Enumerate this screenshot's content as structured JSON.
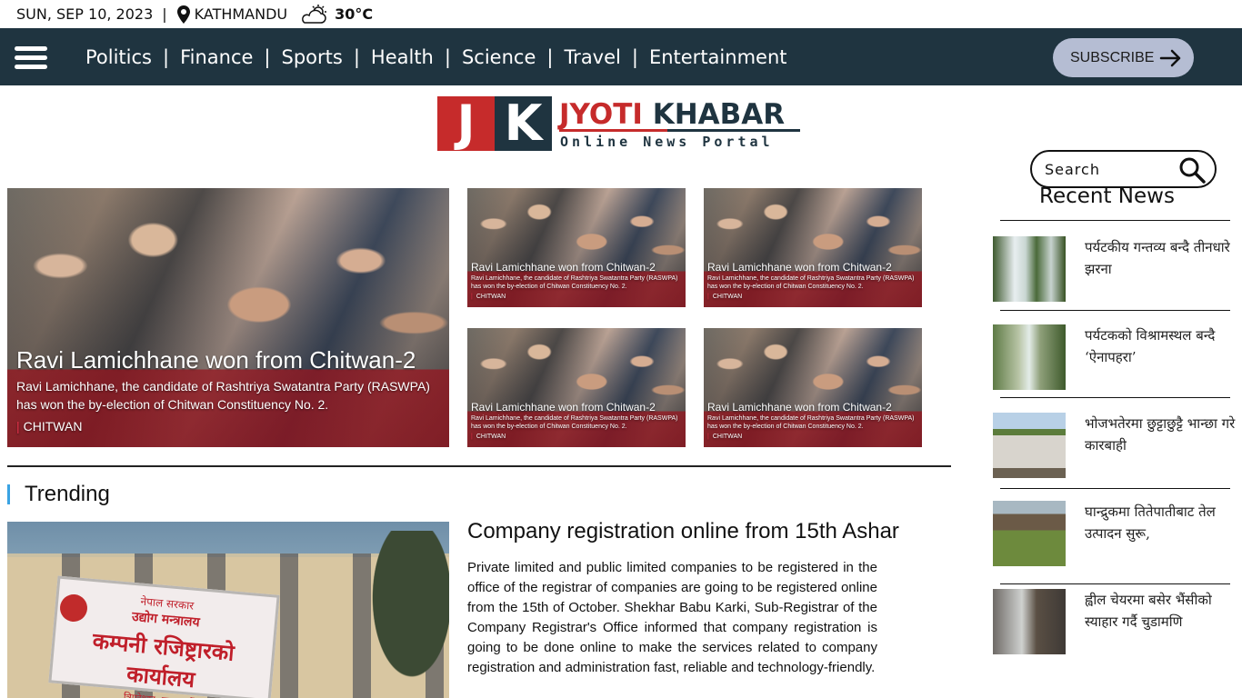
{
  "topbar": {
    "date": "SUN, SEP 10, 2023",
    "separator": "|",
    "location": "KATHMANDU",
    "temperature": "30°C",
    "icons": [
      "location-pin-icon",
      "partly-cloudy-icon"
    ]
  },
  "nav": {
    "items": [
      "Politics",
      "Finance",
      "Sports",
      "Health",
      "Science",
      "Travel",
      "Entertainment"
    ],
    "separator": "|",
    "subscribe_label": "SUBSCRIBE",
    "icons": [
      "hamburger-menu-icon",
      "arrow-right-icon"
    ]
  },
  "logo": {
    "letter_j": "J",
    "letter_k": "K",
    "name_part1": "JYOTI",
    "name_part2": "KHABAR",
    "tagline": "Online News Portal"
  },
  "colors": {
    "nav_bg": "#1f3440",
    "brand_red": "#c62b2b",
    "subscribe_bg": "#b5bdd3",
    "trending_accent": "#3aa3e3",
    "location_tick": "#e6324b"
  },
  "featured": {
    "hero": {
      "title": "Ravi Lamichhane won from Chitwan-2",
      "description": "Ravi Lamichhane, the candidate of Rashtriya Swatantra Party (RASWPA) has won the by-election of Chitwan Constituency No. 2.",
      "location": "CHITWAN"
    },
    "grid": [
      {
        "title": "Ravi Lamichhane won from Chitwan-2",
        "description": "Ravi Lamichhane, the candidate of Rashtriya Swatantra Party (RASWPA) has won the by-election of Chitwan Constituency No. 2.",
        "location": "CHITWAN"
      },
      {
        "title": "Ravi Lamichhane won from Chitwan-2",
        "description": "Ravi Lamichhane, the candidate of Rashtriya Swatantra Party (RASWPA) has won the by-election of Chitwan Constituency No. 2.",
        "location": "CHITWAN"
      },
      {
        "title": "Ravi Lamichhane won from Chitwan-2",
        "description": "Ravi Lamichhane, the candidate of Rashtriya Swatantra Party (RASWPA) has won the by-election of Chitwan Constituency No. 2.",
        "location": "CHITWAN"
      },
      {
        "title": "Ravi Lamichhane won from Chitwan-2",
        "description": "Ravi Lamichhane, the candidate of Rashtriya Swatantra Party (RASWPA) has won the by-election of Chitwan Constituency No. 2.",
        "location": "CHITWAN"
      }
    ]
  },
  "trending": {
    "heading": "Trending",
    "photo_banner": {
      "line1": "नेपाल सरकार",
      "line2": "उद्योग मन्त्रालय",
      "line3": "कम्पनी रजिष्ट्रारको कार्यालय",
      "line4": "त्रिपुरेश्वर, काठमाडौं"
    },
    "article": {
      "title": "Company registration online from 15th Ashar",
      "body": "Private limited and public limited companies to be registered in the office of the registrar of companies are going to be registered online from the 15th of October. Shekhar Babu Karki, Sub-Registrar of the Company Registrar's Office informed that company registration is going to be done online to make the services related to company registration and administration fast, reliable and technology-friendly."
    }
  },
  "sidebar": {
    "search_placeholder": "Search",
    "recent_heading": "Recent News",
    "recent": [
      {
        "title": "पर्यटकीय गन्तव्य बन्दै तीनधारे झरना"
      },
      {
        "title": "पर्यटकको विश्रामस्थल बन्दै ‘ऐनापहरा’"
      },
      {
        "title": "भोजभतेरमा छुट्टाछुट्टै भान्छा गरे कारबाही"
      },
      {
        "title": "घान्द्रुकमा तितेपातीबाट तेल उत्पादन सुरू,"
      },
      {
        "title": "ह्वील चेयरमा बसेर भैंसीको स्याहार गर्दै चुडामणि"
      }
    ]
  }
}
